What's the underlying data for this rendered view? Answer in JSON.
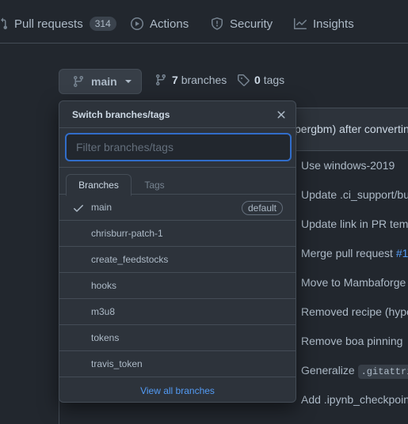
{
  "nav": {
    "pull_requests": "Pull requests",
    "pull_requests_count": "314",
    "actions": "Actions",
    "security": "Security",
    "insights": "Insights"
  },
  "branch_button": {
    "label": "main"
  },
  "branches_link": {
    "count": "7",
    "label": "branches"
  },
  "tags_link": {
    "count": "0",
    "label": "tags"
  },
  "background": {
    "latest_commit": "pergbm) after convertin",
    "commits": [
      {
        "text": "Use windows-2019"
      },
      {
        "text": "Update .ci_support/bu"
      },
      {
        "text": "Update link in PR tem"
      },
      {
        "text": "Merge pull request ",
        "link": "#1"
      },
      {
        "text": "Move to Mambaforge"
      },
      {
        "text": "Removed recipe (hype"
      },
      {
        "text": "Remove boa pinning"
      },
      {
        "text": "Generalize ",
        "code": ".gitattri"
      },
      {
        "text": "Add .ipynb_checkpoin"
      }
    ]
  },
  "dropdown": {
    "title": "Switch branches/tags",
    "filter_placeholder": "Filter branches/tags",
    "tabs": [
      "Branches",
      "Tags"
    ],
    "default_badge": "default",
    "branches": [
      "main",
      "chrisburr-patch-1",
      "create_feedstocks",
      "hooks",
      "m3u8",
      "tokens",
      "travis_token"
    ],
    "view_all": "View all branches"
  },
  "colors": {
    "background": "#22272e",
    "panel": "#2d333b",
    "border": "#444c56",
    "accent_blue": "#539bf5",
    "focus_blue": "#316dca"
  }
}
